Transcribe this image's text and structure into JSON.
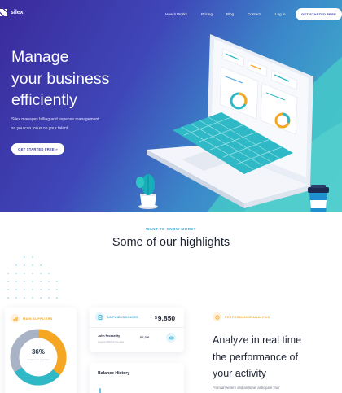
{
  "nav": {
    "brand": "silex",
    "links": [
      "How it Works",
      "Pricing",
      "Blog",
      "Contact",
      "Log in"
    ],
    "cta": "GET STARTED FREE"
  },
  "hero": {
    "title_lines": [
      "Manage",
      "your business",
      "efficiently"
    ],
    "subtitle_lines": [
      "Silex manages billing and expense management",
      "so you can focus on your talent."
    ],
    "cta": "GET STARTED FREE »"
  },
  "highlights": {
    "eyebrow": "WANT TO KNOW MORE?",
    "title": "Some of our highlights"
  },
  "suppliers_card": {
    "label": "MAIN SUPPLIERS",
    "value": "36%",
    "caption": "of spent on suppliers",
    "fraction": 0.36
  },
  "invoices_card": {
    "label": "UNPAID INVOICES",
    "currency": "$",
    "amount": "9,850",
    "row": {
      "name": "John Prosserity",
      "detail": "Invoice #002 of the date",
      "price": "$ 1,250"
    }
  },
  "balance_card": {
    "title": "Balance History"
  },
  "performance": {
    "label": "PERFORMANCE ANALYSIS",
    "title_lines": [
      "Analyze in real time",
      "the performance of",
      "your activity"
    ],
    "body": "From anywhere and anytime, anticipate your"
  },
  "colors": {
    "hero_start": "#3a2a9c",
    "hero_end": "#41c0cc",
    "accent_teal": "#2fb9c6",
    "accent_orange": "#f5a623",
    "accent_blue": "#27a9d8",
    "donut_grey": "#a9b3c6"
  },
  "icons": [
    "logo-mark",
    "chart-icon",
    "invoice-icon",
    "eye-icon",
    "leaf-icon"
  ]
}
